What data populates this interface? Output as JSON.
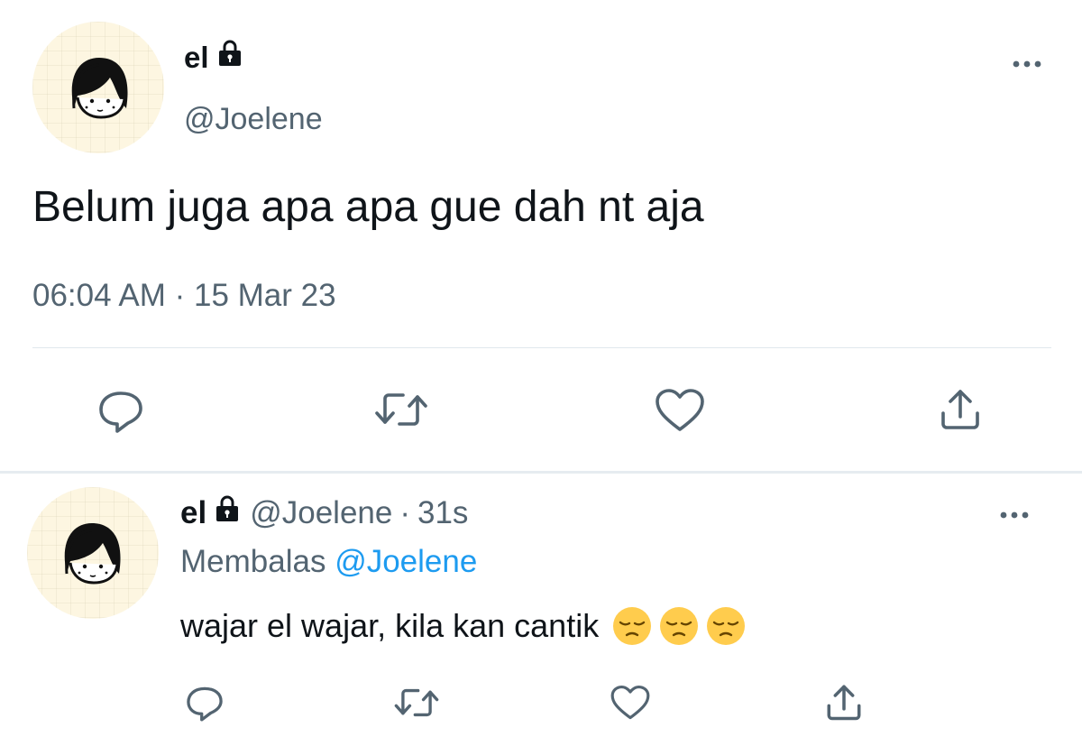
{
  "main_tweet": {
    "display_name": "el",
    "handle": "@Joelene",
    "text": "Belum juga apa apa gue dah nt aja",
    "timestamp": "06:04 AM · 15 Mar 23",
    "protected_icon": "lock-icon",
    "more_icon": "more-horizontal-icon"
  },
  "reply_tweet": {
    "display_name": "el",
    "handle": "@Joelene",
    "separator": "·",
    "age": "31s",
    "replying_label": "Membalas",
    "replying_to": "@Joelene",
    "text": "wajar el wajar, kila kan cantik",
    "emojis": [
      "pensive-face-emoji",
      "pensive-face-emoji",
      "pensive-face-emoji"
    ],
    "protected_icon": "lock-icon",
    "more_icon": "more-horizontal-icon"
  },
  "actions": [
    "reply-icon",
    "retweet-icon",
    "like-icon",
    "share-icon"
  ],
  "colors": {
    "text": "#0f1419",
    "muted": "#536471",
    "link": "#1d9bf0",
    "divider": "#e1e8ed",
    "avatar_bg": "#fdf6e1",
    "emoji": "#ffcc4d"
  }
}
